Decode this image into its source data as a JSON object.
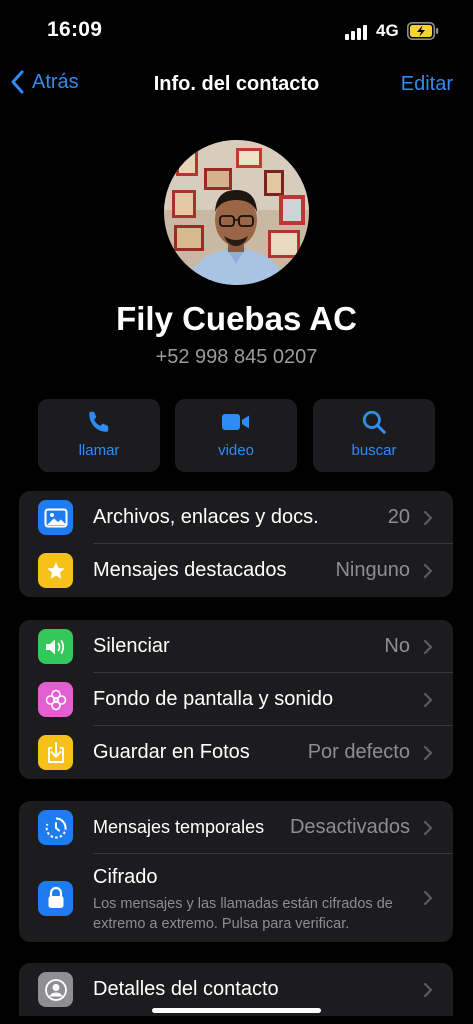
{
  "status_bar": {
    "time": "16:09",
    "network": "4G"
  },
  "nav": {
    "back_label": "Atrás",
    "title": "Info. del contacto",
    "edit_label": "Editar"
  },
  "contact": {
    "name": "Fily Cuebas AC",
    "phone": "+52 998 845 0207"
  },
  "actions": [
    {
      "label": "llamar",
      "icon": "phone-icon"
    },
    {
      "label": "video",
      "icon": "video-icon"
    },
    {
      "label": "buscar",
      "icon": "search-icon"
    }
  ],
  "media_group": [
    {
      "label": "Archivos, enlaces y docs.",
      "value": "20",
      "icon": "photo-icon"
    },
    {
      "label": "Mensajes destacados",
      "value": "Ninguno",
      "icon": "star-icon"
    }
  ],
  "settings_group": [
    {
      "label": "Silenciar",
      "value": "No",
      "icon": "speaker-icon"
    },
    {
      "label": "Fondo de pantalla y sonido",
      "value": "",
      "icon": "flower-icon"
    },
    {
      "label": "Guardar en Fotos",
      "value": "Por defecto",
      "icon": "save-icon"
    }
  ],
  "privacy_group": [
    {
      "label": "Mensajes temporales",
      "value": "Desactivados",
      "icon": "timer-icon"
    },
    {
      "label": "Cifrado",
      "subtitle": "Los mensajes y las llamadas están cifrados de extremo a extremo. Pulsa para verificar.",
      "icon": "lock-icon"
    }
  ],
  "details_group": [
    {
      "label": "Detalles del contacto",
      "icon": "contact-icon"
    }
  ],
  "colors": {
    "accent": "#2f8cf5",
    "background": "#000000",
    "card": "#1c1c1e",
    "secondary_text": "#8d8d92",
    "photo_badge": "#1f7cf0",
    "star_badge": "#f6c21a",
    "speaker_badge": "#34c759",
    "flower_badge": "#e35fd1",
    "save_badge": "#f6c21a",
    "timer_badge": "#1f7cf0",
    "lock_badge": "#1f7cf0",
    "contact_badge": "#8e8e93"
  }
}
